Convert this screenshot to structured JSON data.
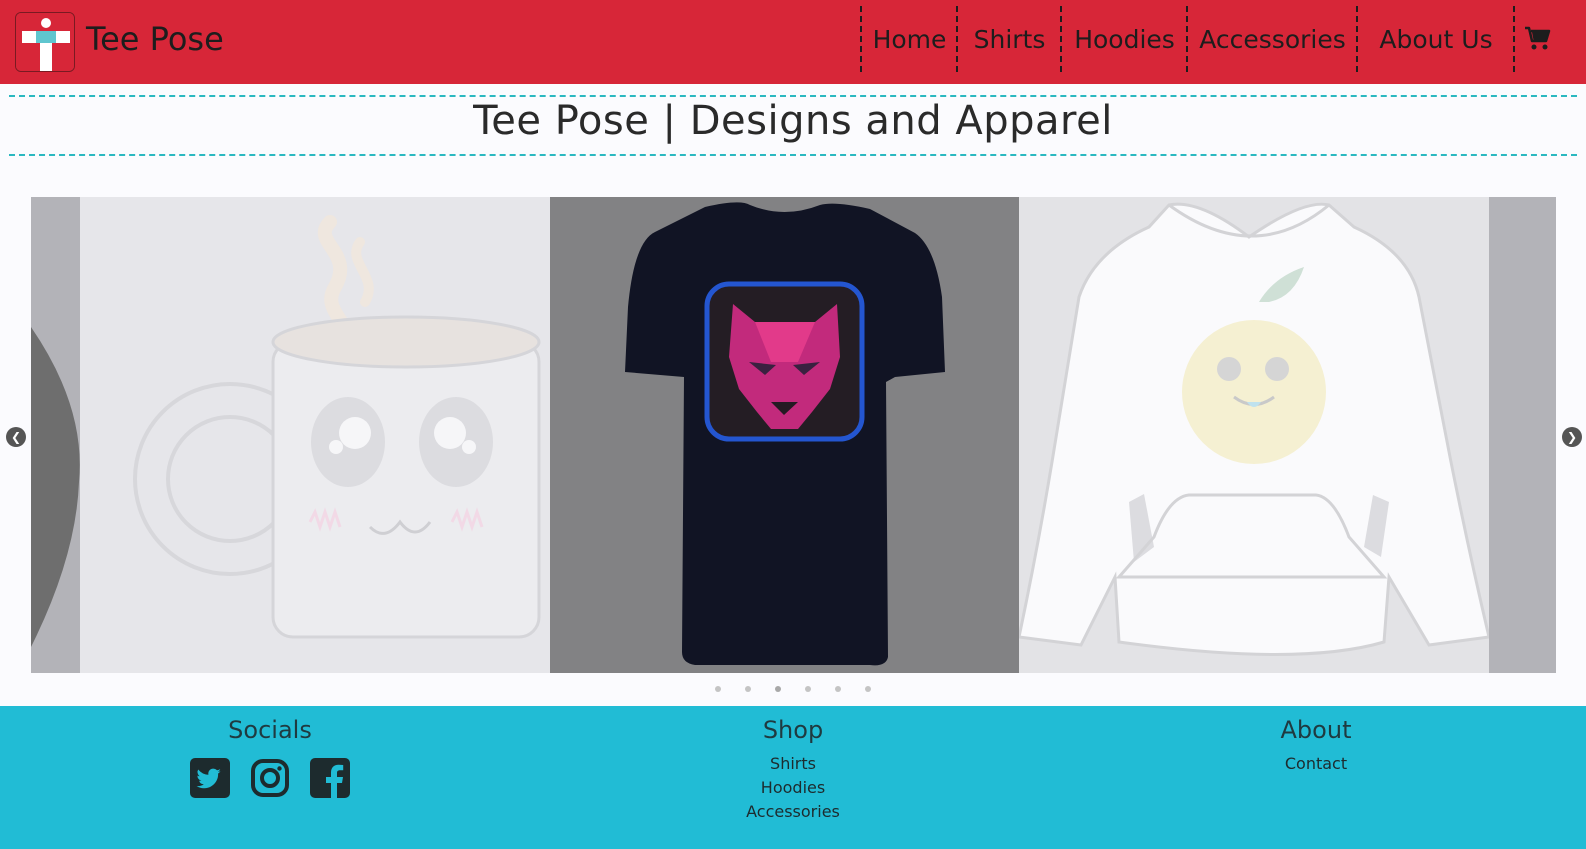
{
  "header": {
    "brand": "Tee Pose",
    "nav": [
      "Home",
      "Shirts",
      "Hoodies",
      "Accessories",
      "About Us"
    ],
    "cart_icon": "shopping-cart-icon"
  },
  "page": {
    "title": "Tee Pose | Designs and Apparel"
  },
  "carousel": {
    "slides": [
      "mug",
      "tshirt",
      "hoodie"
    ],
    "active_slide": 2,
    "dot_count": 6,
    "prev_icon": "chevron-left-icon",
    "next_icon": "chevron-right-icon"
  },
  "footer": {
    "socials": {
      "heading": "Socials",
      "icons": [
        "twitter-icon",
        "instagram-icon",
        "facebook-icon"
      ]
    },
    "shop": {
      "heading": "Shop",
      "links": [
        "Shirts",
        "Hoodies",
        "Accessories"
      ]
    },
    "about": {
      "heading": "About",
      "links": [
        "Contact"
      ]
    }
  },
  "colors": {
    "header_bg": "#d72638",
    "footer_bg": "#21bcd5",
    "rule": "#2bb8c0"
  }
}
